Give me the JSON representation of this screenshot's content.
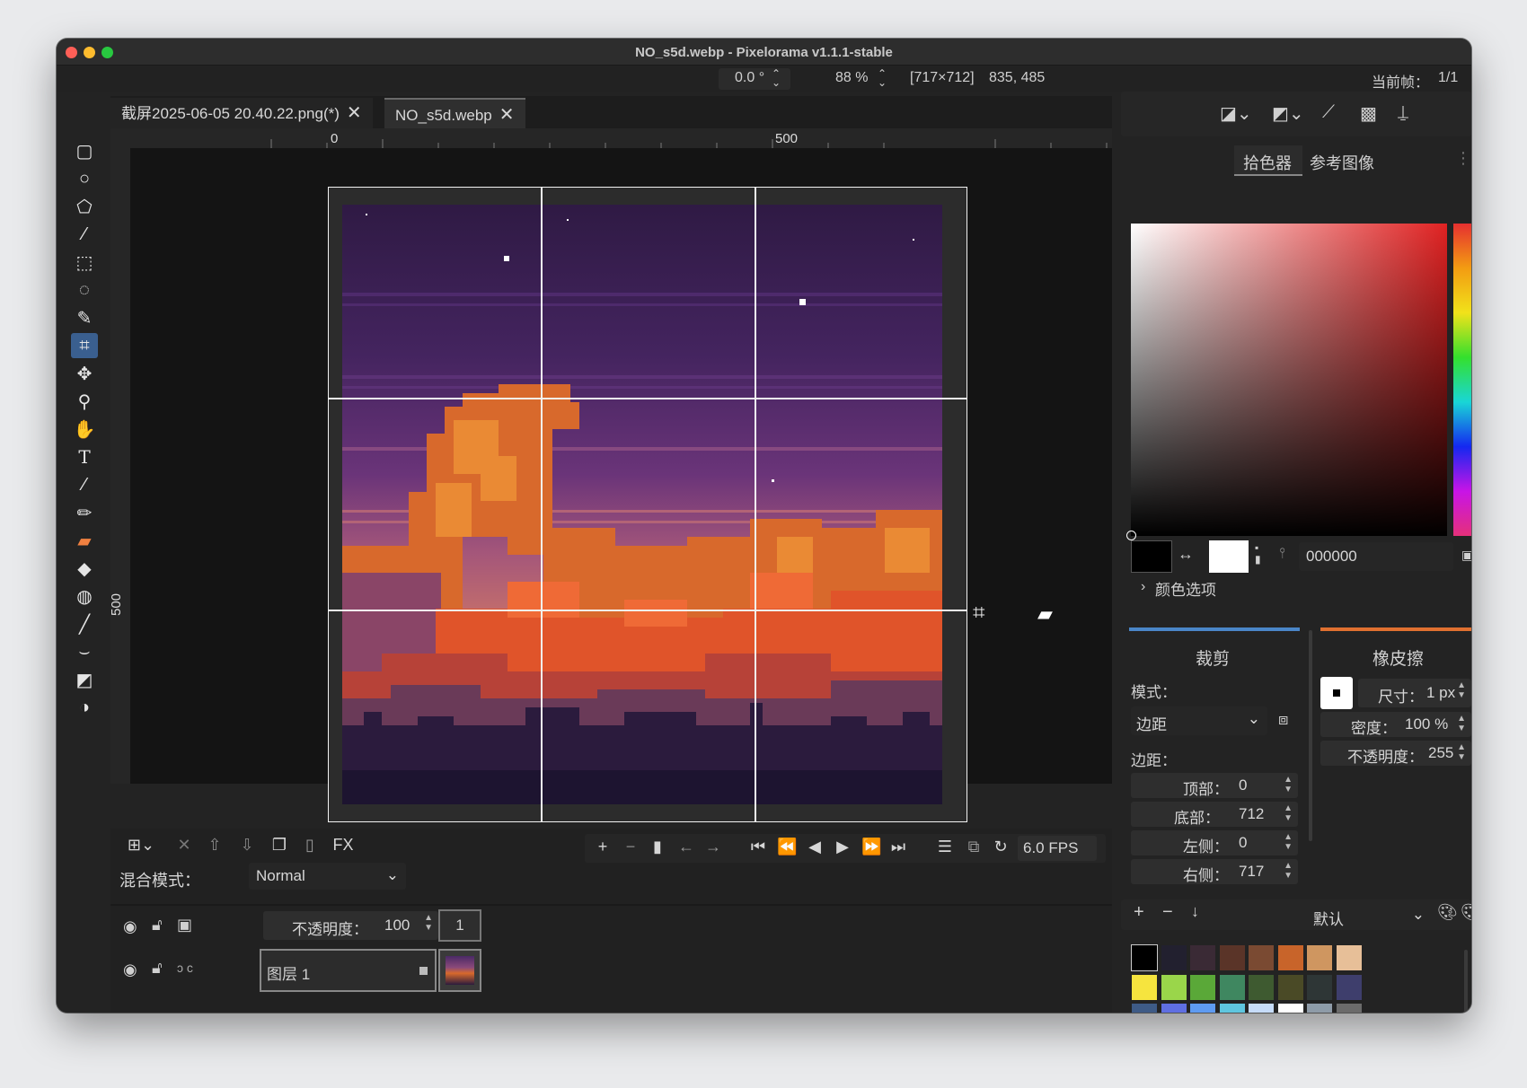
{
  "window": {
    "title": "NO_s5d.webp - Pixelorama v1.1.1-stable"
  },
  "topbar": {
    "rotation": "0.0 °",
    "zoom": "88 %",
    "size": "[717×712]",
    "coords": "835, 485",
    "frame_label": "当前帧：",
    "frame_value": "1/1"
  },
  "tabs": [
    {
      "label": "截屏2025-06-05 20.40.22.png(*)",
      "close": "✕"
    },
    {
      "label": "NO_s5d.webp",
      "close": "✕"
    }
  ],
  "ruler": {
    "h0": "0",
    "h500": "500",
    "v500": "500"
  },
  "tools": [
    "rect-select-icon",
    "ellipse-select-icon",
    "polygon-select-icon",
    "magic-wand-icon",
    "color-select-icon",
    "lasso-icon",
    "pencil-select-icon",
    "crop-icon",
    "move-icon",
    "zoom-icon",
    "pan-icon",
    "text-icon",
    "color-picker-icon",
    "pencil-icon",
    "eraser-icon",
    "bucket-icon",
    "shading-icon",
    "line-icon",
    "curve-icon",
    "rectangle-icon",
    "ellipse-icon"
  ],
  "right_tabs": {
    "picker": "拾色器",
    "reference": "参考图像"
  },
  "color": {
    "hex": "000000",
    "options": "颜色选项",
    "primary": "#000000",
    "secondary": "#ffffff"
  },
  "crop": {
    "title": "裁剪",
    "mode_label": "模式：",
    "mode_value": "边距",
    "margins_label": "边距：",
    "top_label": "顶部：",
    "top_value": "0",
    "bottom_label": "底部：",
    "bottom_value": "712",
    "left_label": "左侧：",
    "left_value": "0",
    "right_label": "右侧：",
    "right_value": "717",
    "accent": "#4a86c8"
  },
  "eraser": {
    "title": "橡皮擦",
    "size_label": "尺寸：",
    "size_value": "1 px",
    "density_label": "密度：",
    "density_value": "100 %",
    "opacity_label": "不透明度：",
    "opacity_value": "255",
    "accent": "#e07030"
  },
  "timeline": {
    "fx": "FX",
    "blend_label": "混合模式：",
    "blend_value": "Normal",
    "opacity_label": "不透明度：",
    "opacity_value": "100",
    "frame_number": "1",
    "layer_name": "图层 1",
    "fps": "6.0 FPS"
  },
  "palette": {
    "name": "默认",
    "colors": [
      "#000000",
      "#22202f",
      "#3a2a35",
      "#5a3428",
      "#7a4a32",
      "#c8642a",
      "#cf9660",
      "#e7bf98",
      "#f6e43e",
      "#9ad64a",
      "#5aa838",
      "#3f8760",
      "#3e5a30",
      "#4a4a26",
      "#2e3636",
      "#3e3e6c",
      "#3e5b86",
      "#5f6fe2",
      "#5e9bf2",
      "#5ec6df",
      "#c6dcfa",
      "#ffffff",
      "#8e9ba8",
      "#6b6b6b"
    ]
  }
}
